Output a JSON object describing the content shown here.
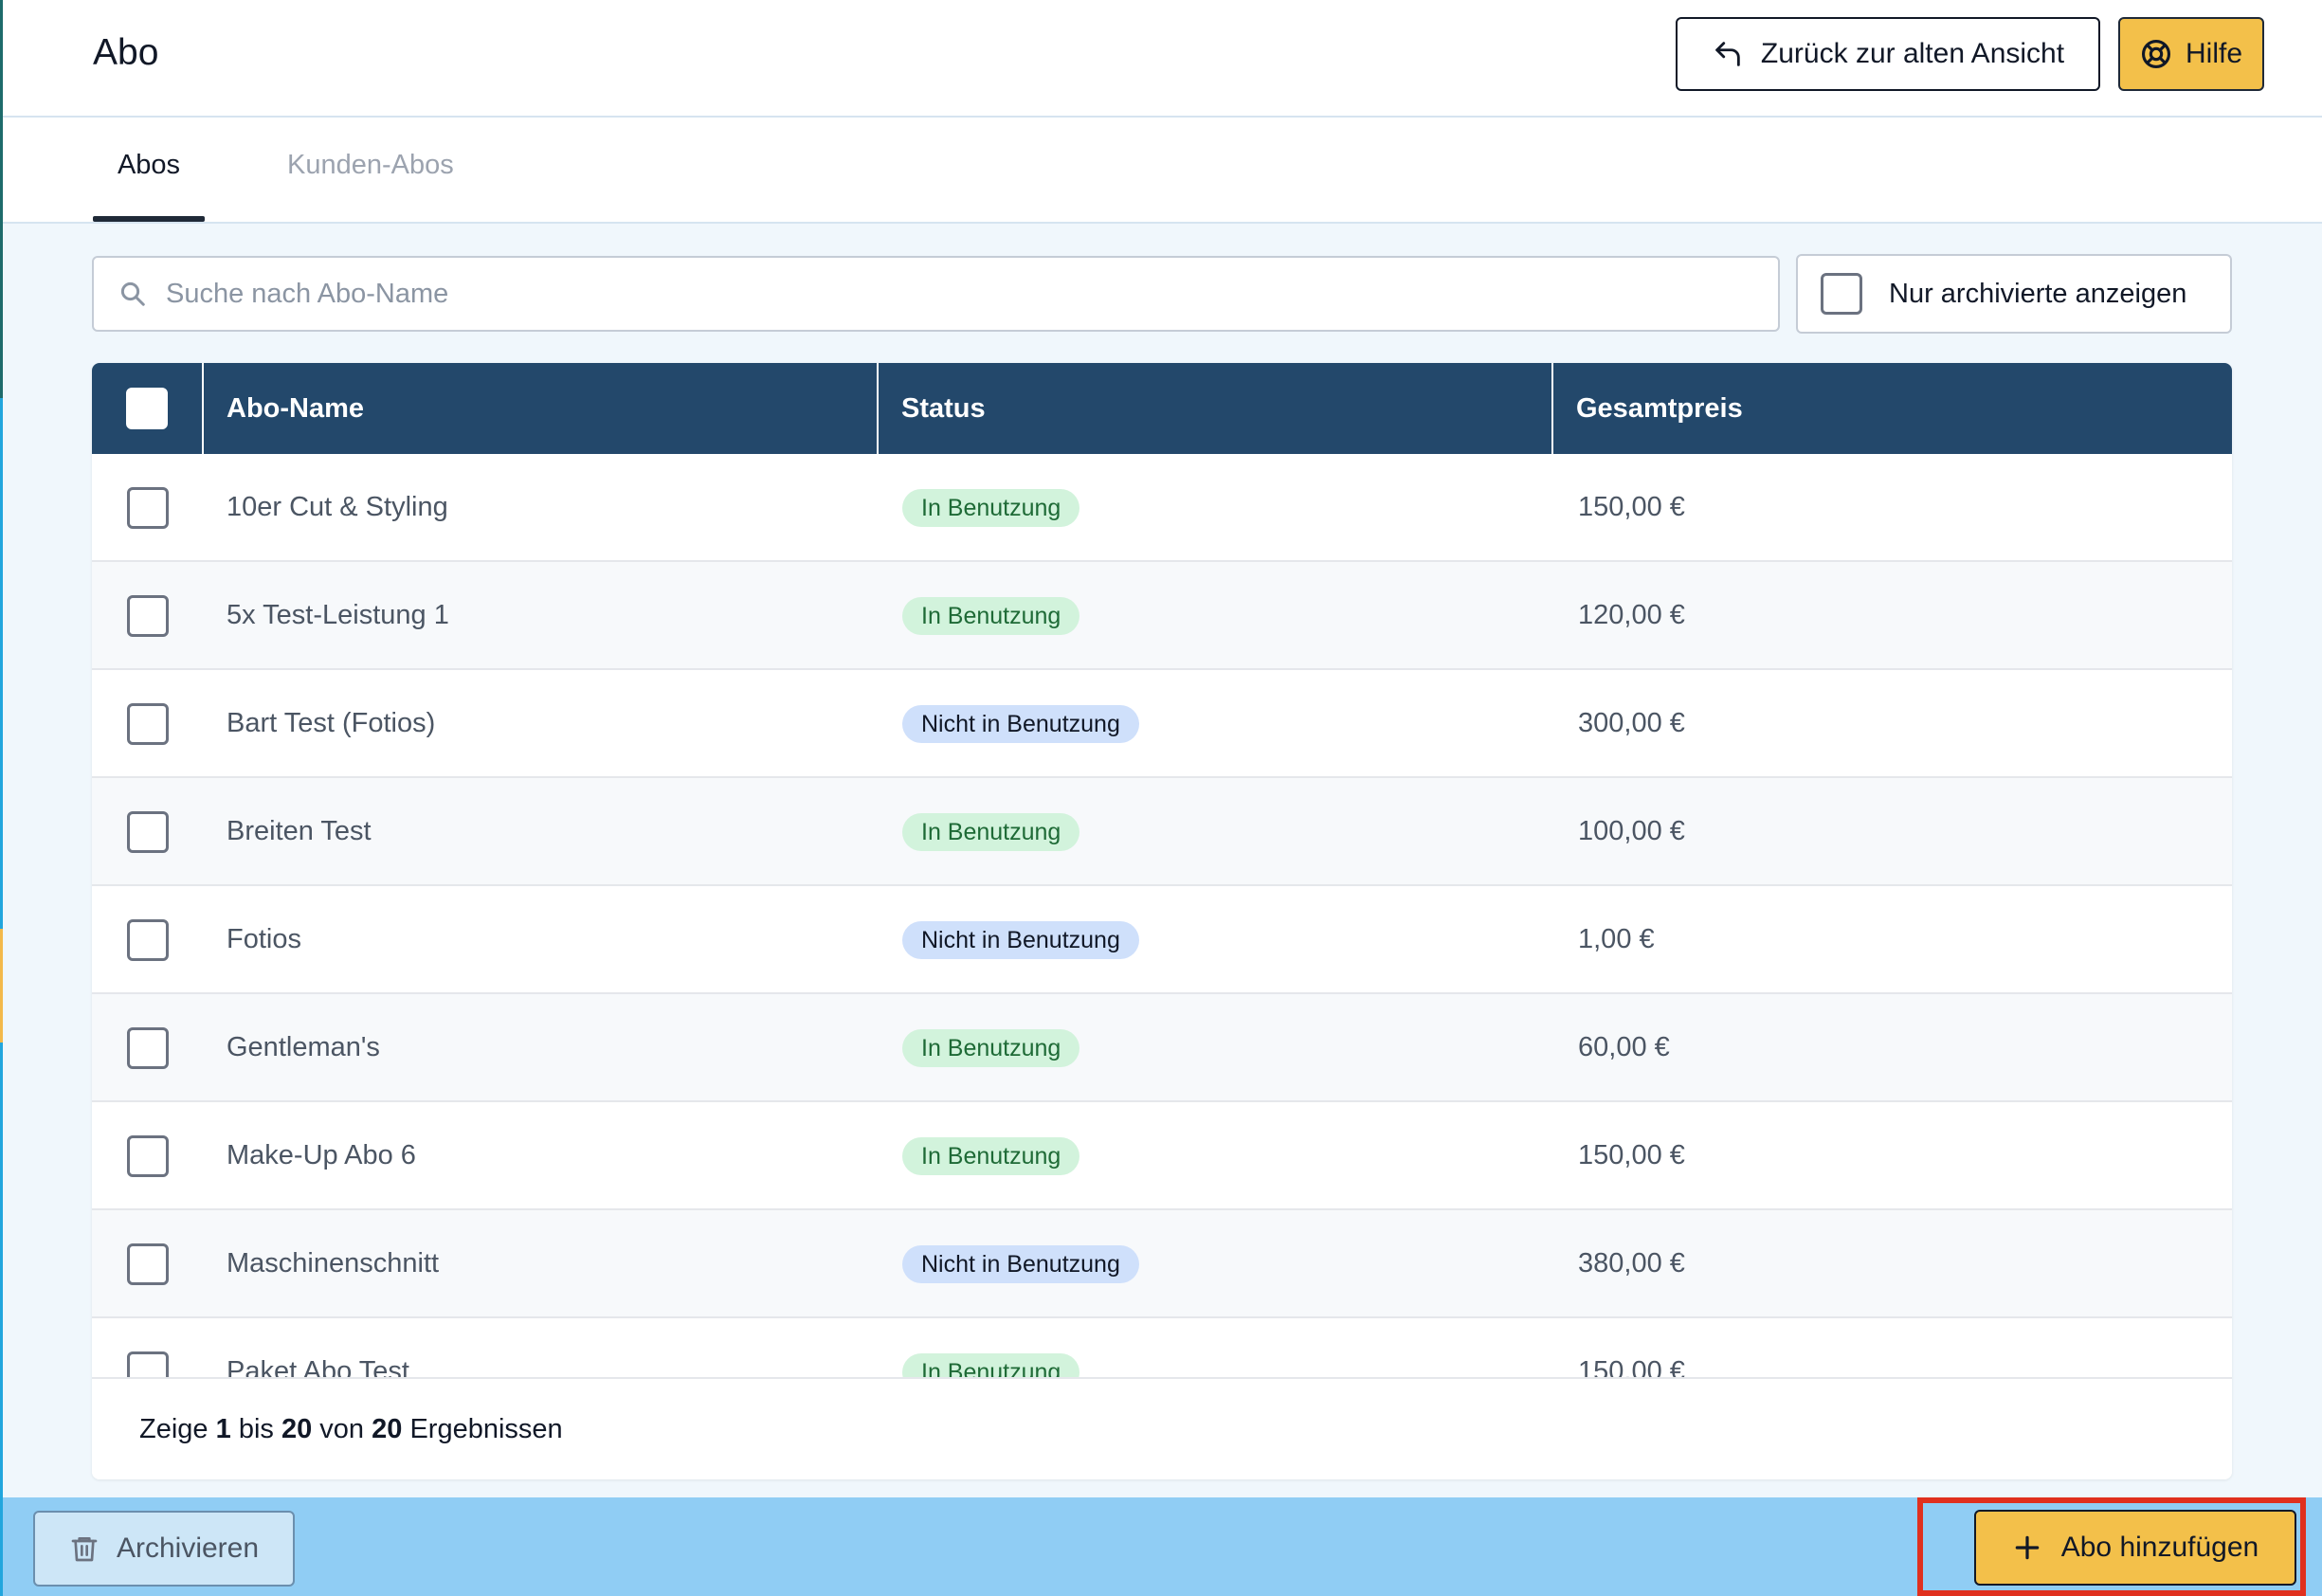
{
  "header": {
    "title": "Abo",
    "back_button": {
      "label": "Zurück zur alten Ansicht",
      "icon": "undo-arrow-icon"
    },
    "help_button": {
      "label": "Hilfe",
      "icon": "lifebuoy-icon"
    }
  },
  "tabs": [
    {
      "label": "Abos",
      "active": true
    },
    {
      "label": "Kunden-Abos",
      "active": false
    }
  ],
  "search": {
    "placeholder": "Suche nach Abo-Name",
    "value": "",
    "icon": "search-icon"
  },
  "archived_filter": {
    "label": "Nur archivierte anzeigen",
    "checked": false
  },
  "table": {
    "columns": [
      "Abo-Name",
      "Status",
      "Gesamtpreis"
    ],
    "rows": [
      {
        "name": "10er Cut & Styling",
        "status": "In Benutzung",
        "price": "150,00 €"
      },
      {
        "name": "5x Test-Leistung 1",
        "status": "In Benutzung",
        "price": "120,00 €"
      },
      {
        "name": "Bart Test (Fotios)",
        "status": "Nicht in Benutzung",
        "price": "300,00 €"
      },
      {
        "name": "Breiten Test",
        "status": "In Benutzung",
        "price": "100,00 €"
      },
      {
        "name": "Fotios",
        "status": "Nicht in Benutzung",
        "price": "1,00 €"
      },
      {
        "name": "Gentleman's",
        "status": "In Benutzung",
        "price": "60,00 €"
      },
      {
        "name": "Make-Up Abo 6",
        "status": "In Benutzung",
        "price": "150,00 €"
      },
      {
        "name": "Maschinenschnitt",
        "status": "Nicht in Benutzung",
        "price": "380,00 €"
      },
      {
        "name": "Paket Abo Test",
        "status": "In Benutzung",
        "price": "150,00 €"
      }
    ]
  },
  "pagination": {
    "prefix": "Zeige",
    "from": "1",
    "to_word": "bis",
    "to": "20",
    "of_word": "von",
    "total": "20",
    "suffix": "Ergebnissen"
  },
  "footer": {
    "archive_button": {
      "label": "Archivieren",
      "icon": "trash-icon"
    },
    "add_button": {
      "label": "Abo hinzufügen",
      "icon": "plus-icon"
    }
  },
  "colors": {
    "table_header": "#23486b",
    "accent_yellow": "#f3c04a",
    "bottom_bar": "#90cdf4",
    "badge_in_use": "#d2f3dc",
    "badge_not_in_use": "#cfe0fb",
    "highlight": "#e0301e"
  }
}
